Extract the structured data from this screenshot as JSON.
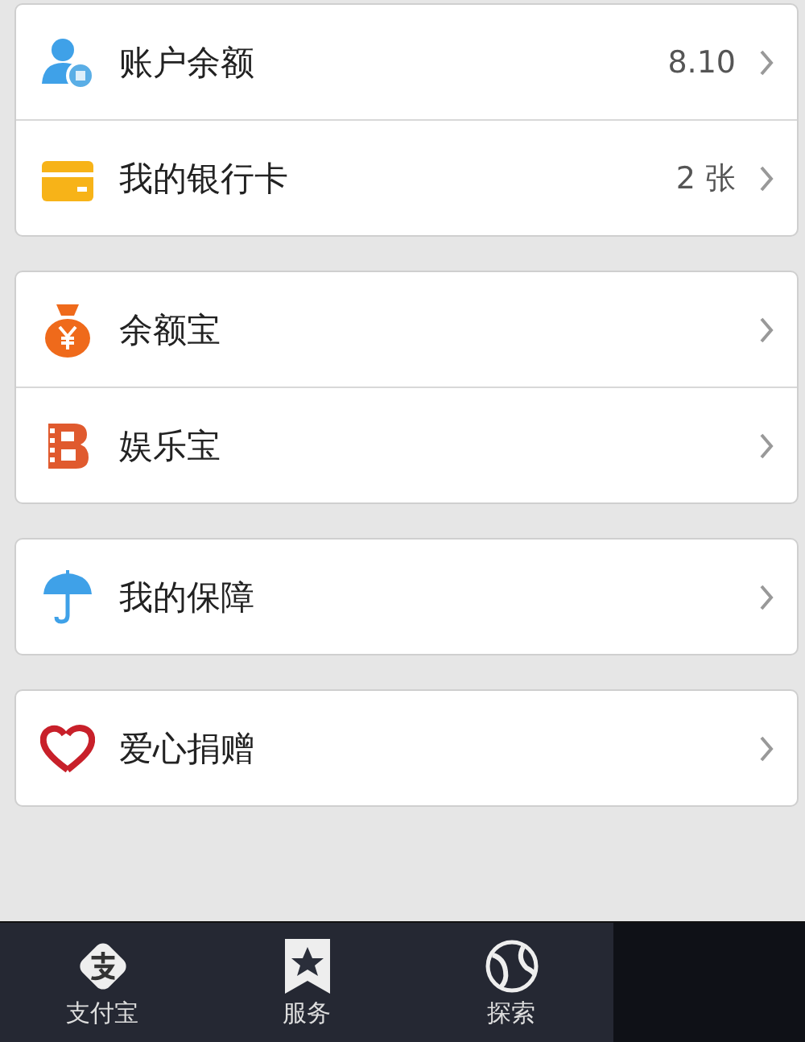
{
  "groups": [
    {
      "items": [
        {
          "label": "账户余额",
          "value": "8.10"
        },
        {
          "label": "我的银行卡",
          "value": "2 张"
        }
      ]
    },
    {
      "items": [
        {
          "label": "余额宝"
        },
        {
          "label": "娱乐宝"
        }
      ]
    },
    {
      "items": [
        {
          "label": "我的保障"
        }
      ]
    },
    {
      "items": [
        {
          "label": "爱心捐赠"
        }
      ]
    }
  ],
  "tab_bar": [
    {
      "label": "支付宝"
    },
    {
      "label": "服务"
    },
    {
      "label": "探索"
    }
  ]
}
